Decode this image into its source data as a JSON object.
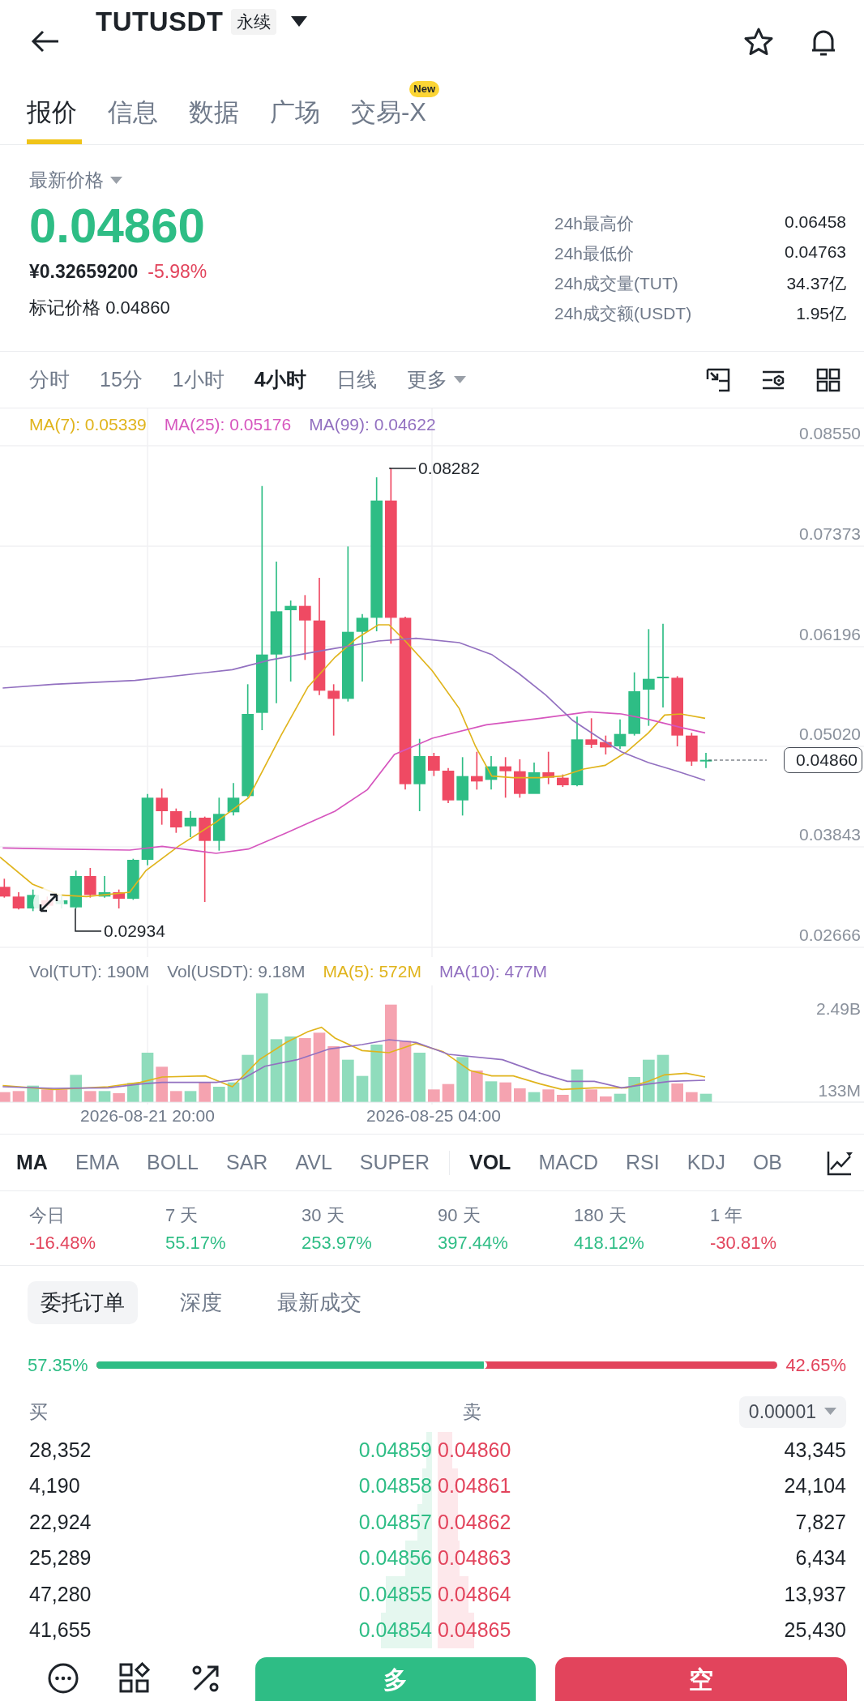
{
  "header": {
    "title": "TUTUSDT",
    "badge": "永续"
  },
  "tabs": [
    {
      "label": "报价",
      "selected": true
    },
    {
      "label": "信息",
      "selected": false
    },
    {
      "label": "数据",
      "selected": false
    },
    {
      "label": "广场",
      "selected": false
    },
    {
      "label": "交易-X",
      "selected": false,
      "badge": "New"
    }
  ],
  "price": {
    "label": "最新价格",
    "last": {
      "text": "0.04860",
      "color": "#2ebd85"
    },
    "fiat": "¥0.32659200",
    "change": {
      "text": "-5.98%",
      "color": "#e2445c"
    },
    "mark_label": "标记价格",
    "mark_value": "0.04860"
  },
  "stats": [
    {
      "label": "24h最高价",
      "value": "0.06458"
    },
    {
      "label": "24h最低价",
      "value": "0.04763"
    },
    {
      "label": "24h成交量(TUT)",
      "value": "34.37亿"
    },
    {
      "label": "24h成交额(USDT)",
      "value": "1.95亿"
    }
  ],
  "intervals": [
    {
      "label": "分时",
      "selected": false,
      "kind": "option"
    },
    {
      "label": "15分",
      "selected": false,
      "kind": "option"
    },
    {
      "label": "1小时",
      "selected": false,
      "kind": "option"
    },
    {
      "label": "4小时",
      "selected": true,
      "kind": "option"
    },
    {
      "label": "日线",
      "selected": false,
      "kind": "option"
    },
    {
      "label": "更多",
      "selected": false,
      "kind": "menu"
    }
  ],
  "chart": {
    "ma": [
      {
        "label": "MA(7): 0.05339",
        "color": "#e0b41c"
      },
      {
        "label": "MA(25): 0.05176",
        "color": "#d656be"
      },
      {
        "label": "MA(99): 0.04622",
        "color": "#9270c0"
      }
    ],
    "price_ticks": [
      "0.08550",
      "0.07373",
      "0.06196",
      "0.05020",
      "0.03843",
      "0.02666"
    ],
    "high": "0.08282",
    "low": "0.02934",
    "current": "0.04860",
    "volume_legend": [
      {
        "label": "Vol(TUT): 190M",
        "color": "#707a8a"
      },
      {
        "label": "Vol(USDT): 9.18M",
        "color": "#707a8a"
      },
      {
        "label": "MA(5): 572M",
        "color": "#e0b41c"
      },
      {
        "label": "MA(10): 477M",
        "color": "#9270c0"
      }
    ],
    "volume_ticks": [
      "2.49B",
      "133M"
    ],
    "dates": [
      "2026-08-21 20:00",
      "2026-08-25 04:00"
    ]
  },
  "indicators": {
    "main": [
      {
        "label": "MA",
        "selected": true
      },
      {
        "label": "EMA",
        "selected": false
      },
      {
        "label": "BOLL",
        "selected": false
      },
      {
        "label": "SAR",
        "selected": false
      },
      {
        "label": "AVL",
        "selected": false
      },
      {
        "label": "SUPER",
        "selected": false
      }
    ],
    "sub": [
      {
        "label": "VOL",
        "selected": true
      },
      {
        "label": "MACD",
        "selected": false
      },
      {
        "label": "RSI",
        "selected": false
      },
      {
        "label": "KDJ",
        "selected": false
      },
      {
        "label": "OB",
        "selected": false
      }
    ]
  },
  "periods": [
    {
      "label": "今日",
      "value": "-16.48%",
      "color": "#e2445c"
    },
    {
      "label": "7 天",
      "value": "55.17%",
      "color": "#2ebd85"
    },
    {
      "label": "30 天",
      "value": "253.97%",
      "color": "#2ebd85"
    },
    {
      "label": "90 天",
      "value": "397.44%",
      "color": "#2ebd85"
    },
    {
      "label": "180 天",
      "value": "418.12%",
      "color": "#2ebd85"
    },
    {
      "label": "1 年",
      "value": "-30.81%",
      "color": "#e2445c"
    }
  ],
  "order_book": {
    "tabs": [
      {
        "label": "委托订单",
        "selected": true
      },
      {
        "label": "深度",
        "selected": false
      },
      {
        "label": "最新成交",
        "selected": false
      }
    ],
    "ratio": {
      "buy": "57.35%",
      "sell": "42.65%",
      "level": 0.5735
    },
    "buy_header": "买",
    "sell_header": "卖",
    "precision": "0.00001",
    "rows": [
      {
        "bid": {
          "amount": "28,352",
          "price": "0.04859"
        },
        "ask": {
          "price": "0.04860",
          "amount": "43,345"
        }
      },
      {
        "bid": {
          "amount": "4,190",
          "price": "0.04858"
        },
        "ask": {
          "price": "0.04861",
          "amount": "24,104"
        }
      },
      {
        "bid": {
          "amount": "22,924",
          "price": "0.04857"
        },
        "ask": {
          "price": "0.04862",
          "amount": "7,827"
        }
      },
      {
        "bid": {
          "amount": "25,289",
          "price": "0.04856"
        },
        "ask": {
          "price": "0.04863",
          "amount": "6,434"
        }
      },
      {
        "bid": {
          "amount": "47,280",
          "price": "0.04855"
        },
        "ask": {
          "price": "0.04864",
          "amount": "13,937"
        }
      },
      {
        "bid": {
          "amount": "41,655",
          "price": "0.04854"
        },
        "ask": {
          "price": "0.04865",
          "amount": "25,430"
        }
      }
    ]
  },
  "actions": {
    "buy": "多",
    "sell": "空"
  }
}
